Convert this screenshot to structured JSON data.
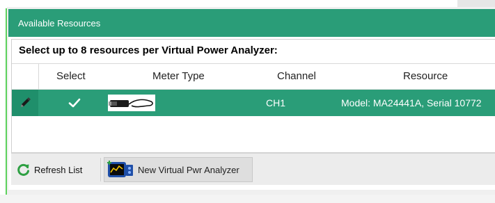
{
  "panel": {
    "title": "Available Resources",
    "instruction": "Select up to 8 resources per Virtual Power Analyzer:"
  },
  "grid": {
    "columns": [
      "Select",
      "Meter Type",
      "Channel",
      "Resource"
    ],
    "rows": [
      {
        "selected": true,
        "meter_type_icon": "power-sensor-image",
        "channel": "CH1",
        "resource": "Model: MA24441A, Serial 10772"
      }
    ]
  },
  "toolbar": {
    "refresh_label": "Refresh List",
    "new_analyzer_label": "New Virtual Pwr Analyzer"
  },
  "colors": {
    "accent": "#2a9d78",
    "refresh_icon": "#2ea043"
  }
}
